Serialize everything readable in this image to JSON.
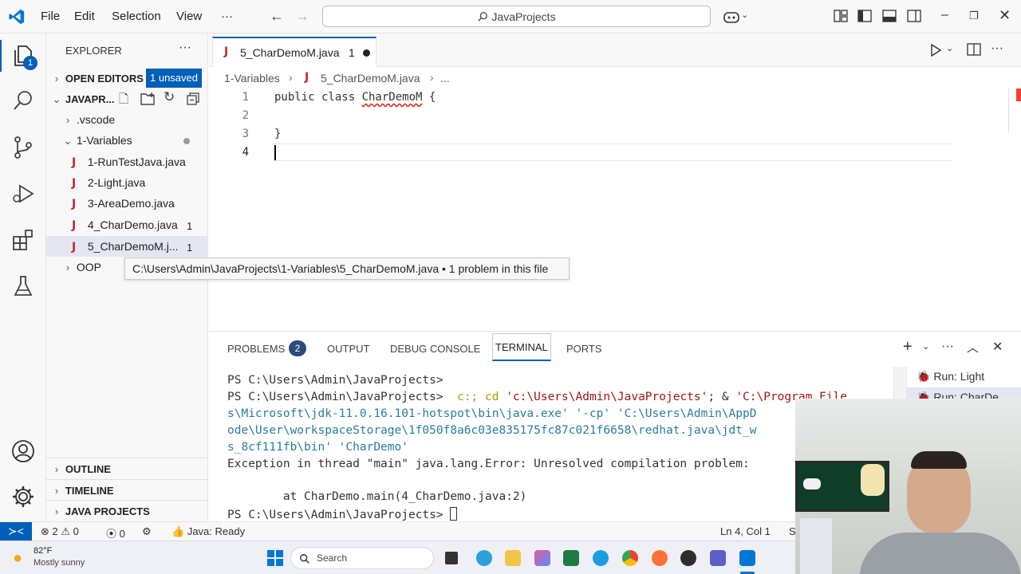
{
  "titlebar": {
    "menu": [
      "File",
      "Edit",
      "Selection",
      "View",
      "···"
    ],
    "search_text": "JavaProjects"
  },
  "activity": {
    "explorer_badge": "1"
  },
  "sidebar": {
    "title": "EXPLORER",
    "more": "···",
    "open_editors": "OPEN EDITORS",
    "unsaved_badge": "1 unsaved",
    "project_name": "JAVAPR...",
    "vscode_folder": ".vscode",
    "variables_folder": "1-Variables",
    "files": [
      {
        "name": "1-RunTestJava.java",
        "count": ""
      },
      {
        "name": "2-Light.java",
        "count": ""
      },
      {
        "name": "3-AreaDemo.java",
        "count": ""
      },
      {
        "name": "4_CharDemo.java",
        "count": "1"
      },
      {
        "name": "5_CharDemoM.j...",
        "count": "1"
      }
    ],
    "oop_folder": "OOP",
    "outline": "OUTLINE",
    "timeline": "TIMELINE",
    "java_projects": "JAVA PROJECTS"
  },
  "tooltip": "C:\\Users\\Admin\\JavaProjects\\1-Variables\\5_CharDemoM.java • 1 problem in this file",
  "editor": {
    "tab_label": "5_CharDemoM.java",
    "tab_count": "1",
    "breadcrumb": [
      "1-Variables",
      "5_CharDemoM.java",
      "..."
    ],
    "lines": [
      {
        "n": "1",
        "kw": "public class ",
        "cls": "CharDemoM",
        "rest": " {"
      },
      {
        "n": "2",
        "text": ""
      },
      {
        "n": "3",
        "text": "}"
      },
      {
        "n": "4",
        "text": ""
      }
    ]
  },
  "panel": {
    "tabs": [
      "PROBLEMS",
      "OUTPUT",
      "DEBUG CONSOLE",
      "TERMINAL",
      "PORTS"
    ],
    "problems_count": "2",
    "terminal": [
      "PS C:\\Users\\Admin\\JavaProjects>",
      "PS C:\\Users\\Admin\\JavaProjects>  c:; cd 'c:\\Users\\Admin\\JavaProjects'; & 'C:\\Program File",
      "s\\Microsoft\\jdk-11.0.16.101-hotspot\\bin\\java.exe' '-cp' 'C:\\Users\\Admin\\AppD",
      "ode\\User\\workspaceStorage\\1f050f8a6c03e835175fc87c021f6658\\redhat.java\\jdt_w",
      "s_8cf111fb\\bin' 'CharDemo'",
      "Exception in thread \"main\" java.lang.Error: Unresolved compilation problem:",
      "",
      "        at CharDemo.main(4_CharDemo.java:2)",
      "PS C:\\Users\\Admin\\JavaProjects> "
    ],
    "run_items": [
      "Run: Light",
      "Run: CharDe..."
    ]
  },
  "statusbar": {
    "errors": "2",
    "warnings": "0",
    "ports": "0",
    "java_status": "Java: Ready",
    "cursor": "Ln 4, Col 1",
    "trailing": "S"
  },
  "taskbar": {
    "temp": "82°F",
    "weather": "Mostly sunny",
    "search": "Search"
  },
  "colors": {
    "accent": "#005fb8",
    "java_red": "#c5282f",
    "error_squiggle": "#e51400"
  }
}
